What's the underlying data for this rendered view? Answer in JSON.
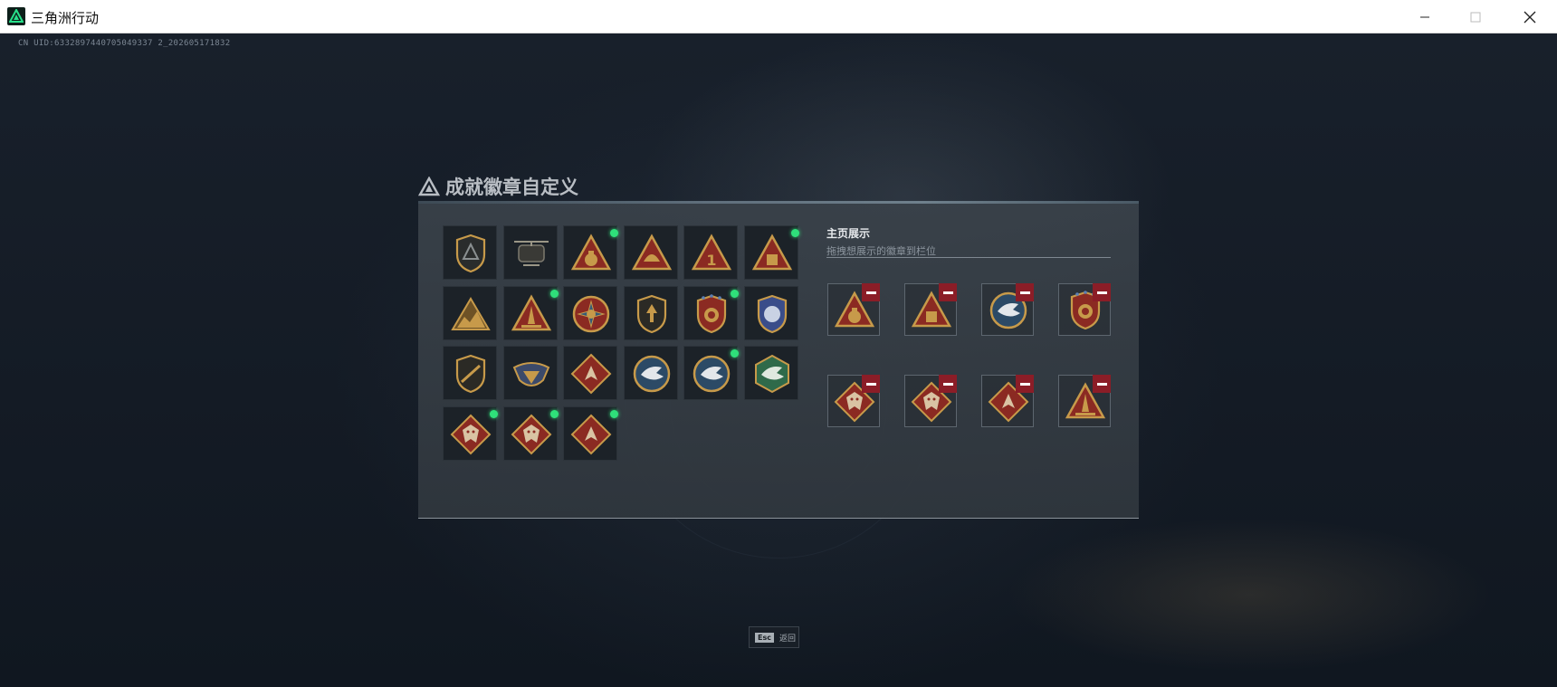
{
  "window": {
    "title": "三角洲行动",
    "controls": {
      "minimize": "minimize-icon",
      "maximize": "maximize-icon",
      "close": "close-icon"
    }
  },
  "uid": "CN UID:6332897440705049337 2_202605171832",
  "dialog": {
    "title": "成就徽章自定义",
    "showcase": {
      "title": "主页展示",
      "subtitle": "拖拽想展示的徽章到栏位",
      "slots": [
        {
          "badge": "moneybag-triangle-badge"
        },
        {
          "badge": "gold-bar-triangle-badge"
        },
        {
          "badge": "eagle-round-badge"
        },
        {
          "badge": "star-shield-badge"
        },
        {
          "badge": "red-dragon-diamond-badge"
        },
        {
          "badge": "red-dragon-diamond-badge"
        },
        {
          "badge": "red-wolf-diamond-badge"
        },
        {
          "badge": "spike-triangle-badge"
        }
      ]
    },
    "badges": [
      {
        "name": "delta-shield-badge",
        "new": false
      },
      {
        "name": "helicopter-badge",
        "new": false
      },
      {
        "name": "moneybag-triangle-badge",
        "new": true
      },
      {
        "name": "helmet-triangle-badge",
        "new": false
      },
      {
        "name": "number-one-triangle-badge",
        "new": false
      },
      {
        "name": "gold-bar-triangle-badge",
        "new": true
      },
      {
        "name": "mountain-triangle-badge",
        "new": false
      },
      {
        "name": "spike-triangle-badge",
        "new": true
      },
      {
        "name": "cross-round-badge",
        "new": false
      },
      {
        "name": "arrow-shield-badge",
        "new": false
      },
      {
        "name": "star-shield-badge",
        "new": true
      },
      {
        "name": "blue-crest-badge",
        "new": false
      },
      {
        "name": "rifle-shield-badge",
        "new": false
      },
      {
        "name": "winged-crest-badge",
        "new": false
      },
      {
        "name": "red-wolf-diamond-badge",
        "new": false
      },
      {
        "name": "eagle-round-badge",
        "new": false
      },
      {
        "name": "eagle-round-badge",
        "new": true
      },
      {
        "name": "green-eagle-hex-badge",
        "new": false
      },
      {
        "name": "red-dragon-diamond-badge",
        "new": true
      },
      {
        "name": "red-dragon-diamond-badge",
        "new": true
      },
      {
        "name": "red-wolf-diamond-badge",
        "new": true
      }
    ]
  },
  "footer": {
    "esc_key": "Esc",
    "esc_label": "返回"
  },
  "colors": {
    "new_dot": "#2fe07a",
    "remove": "#8b1d27",
    "gold": "#c79a4a",
    "panel": "#3a4249"
  }
}
